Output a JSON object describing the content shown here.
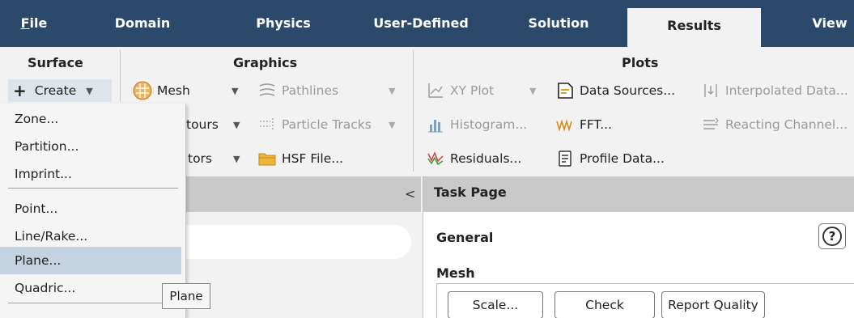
{
  "menubar": {
    "tabs": [
      {
        "label": "File",
        "mnemonic": "F",
        "rest": "ile"
      },
      {
        "label": "Domain"
      },
      {
        "label": "Physics"
      },
      {
        "label": "User-Defined"
      },
      {
        "label": "Solution"
      },
      {
        "label": "Results",
        "active": true
      },
      {
        "label": "View"
      }
    ]
  },
  "ribbon": {
    "surface": {
      "title": "Surface",
      "create_label": "Create",
      "create_icon": "plus-icon"
    },
    "graphics": {
      "title": "Graphics",
      "mesh": "Mesh",
      "contours": "tours",
      "vectors": "tors",
      "pathlines": "Pathlines",
      "particle_tracks": "Particle Tracks",
      "hsf_file": "HSF File..."
    },
    "plots": {
      "title": "Plots",
      "xy_plot": "XY Plot",
      "histogram": "Histogram...",
      "residuals": "Residuals...",
      "data_sources": "Data Sources...",
      "fft": "FFT...",
      "profile_data": "Profile Data...",
      "interpolated_data": "Interpolated Data...",
      "reacting_channel": "Reacting Channel..."
    }
  },
  "dropdown": {
    "items": [
      "Zone...",
      "Partition...",
      "Imprint...",
      "Point...",
      "Line/Rake...",
      "Plane...",
      "Quadric..."
    ],
    "highlighted": "Plane..."
  },
  "tooltip": {
    "text": "Plane"
  },
  "task_page": {
    "header": "Task Page",
    "general_title": "General",
    "help_label": "?",
    "mesh_title": "Mesh",
    "buttons": {
      "scale": "Scale...",
      "check": "Check",
      "report_quality": "Report Quality"
    }
  },
  "left_panel": {
    "collapse_glyph": "<"
  },
  "colors": {
    "menubar_bg": "#2b4a6b",
    "highlight": "#c5d2e0",
    "panel_header": "#c9c9c9"
  }
}
